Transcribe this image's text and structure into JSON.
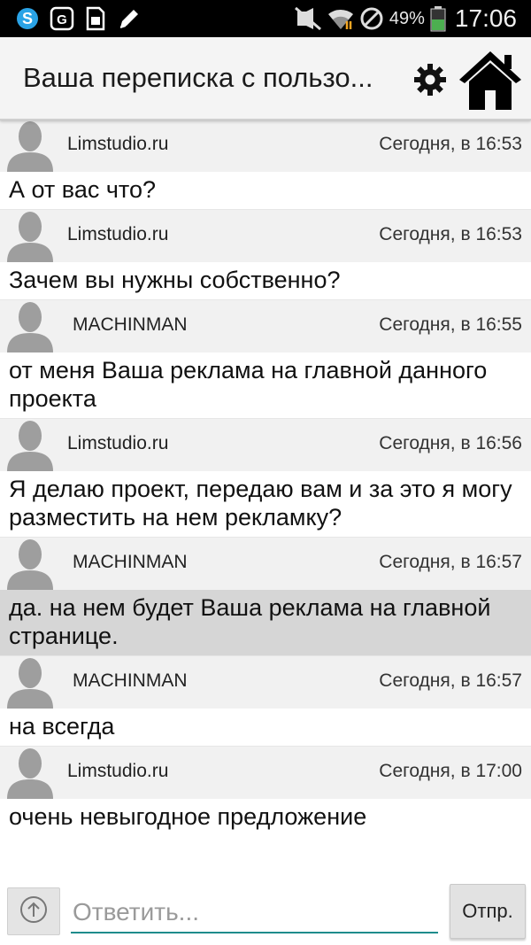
{
  "status_bar": {
    "icons_left": [
      "skype-icon",
      "cyanogen-icon",
      "sim-card-icon",
      "pencil-icon"
    ],
    "icons_right": [
      "mute-icon",
      "wifi-icon",
      "no-sync-icon",
      "battery-icon"
    ],
    "battery_percent": "49%",
    "battery_level": 0.49,
    "time": "17:06",
    "battery_color": "#4caf50"
  },
  "header": {
    "title": "Ваша переписка с пользо...",
    "icons": [
      "settings-gear-icon",
      "home-icon"
    ]
  },
  "messages": [
    {
      "sender": "Limstudio.ru",
      "time": "Сегодня, в 16:53",
      "text": "А от вас что?",
      "highlighted": false
    },
    {
      "sender": "Limstudio.ru",
      "time": "Сегодня, в 16:53",
      "text": "Зачем вы нужны собственно?",
      "highlighted": false
    },
    {
      "sender": "MACHINMAN",
      "time": "Сегодня, в 16:55",
      "text": "от меня Ваша реклама на главной данного проекта",
      "highlighted": false
    },
    {
      "sender": "Limstudio.ru",
      "time": "Сегодня, в 16:56",
      "text": "Я делаю проект, передаю вам и за это я могу разместить на нем рекламку?",
      "highlighted": false
    },
    {
      "sender": "MACHINMAN",
      "time": "Сегодня, в 16:57",
      "text": "да. на нем будет Ваша реклама на главной странице.",
      "highlighted": true
    },
    {
      "sender": "MACHINMAN",
      "time": "Сегодня, в 16:57",
      "text": "на всегда",
      "highlighted": false
    },
    {
      "sender": "Limstudio.ru",
      "time": "Сегодня, в 17:00",
      "text": "очень невыгодное предложение",
      "highlighted": false
    }
  ],
  "reply": {
    "attach_icon": "upload-arrow-icon",
    "placeholder": "Ответить...",
    "value": "",
    "send_label": "Отпр."
  },
  "colors": {
    "header_bg": "#f4f4f4",
    "message_header_bg": "#f1f1f1",
    "highlight_bg": "#d6d6d6",
    "input_underline": "#1e8c8c"
  }
}
